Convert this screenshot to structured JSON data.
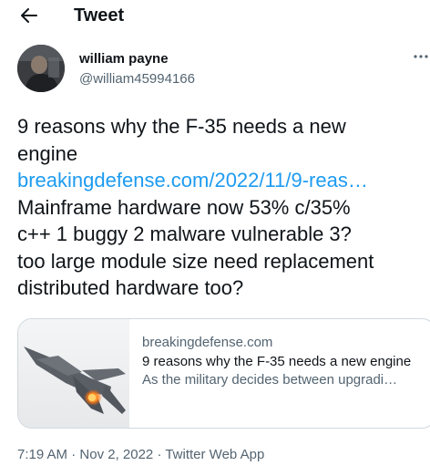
{
  "header": {
    "back_icon": "arrow-left-icon",
    "title": "Tweet"
  },
  "author": {
    "name": "william payne",
    "handle": "@william45994166",
    "more_icon": "more-dots-icon"
  },
  "tweet": {
    "line1": "9 reasons why the F-35 needs a new",
    "line2": "engine",
    "link_text": "breakingdefense.com/2022/11/9-reas…",
    "line4": "Mainframe hardware now 53% c/35%",
    "line5": "c++ 1 buggy 2 malware vulnerable 3?",
    "line6": "too large module size need replacement",
    "line7": "distributed hardware too?"
  },
  "card": {
    "domain": "breakingdefense.com",
    "title": "9 reasons why the F-35 needs a new engine",
    "description": "As the military decides between upgradi…"
  },
  "meta": {
    "time": "7:19 AM",
    "separator": " · ",
    "date": "Nov 2, 2022",
    "source": "Twitter Web App"
  },
  "colors": {
    "text": "#0f1419",
    "secondary": "#536471",
    "link": "#1d9bf0",
    "border": "#cfd9de"
  }
}
